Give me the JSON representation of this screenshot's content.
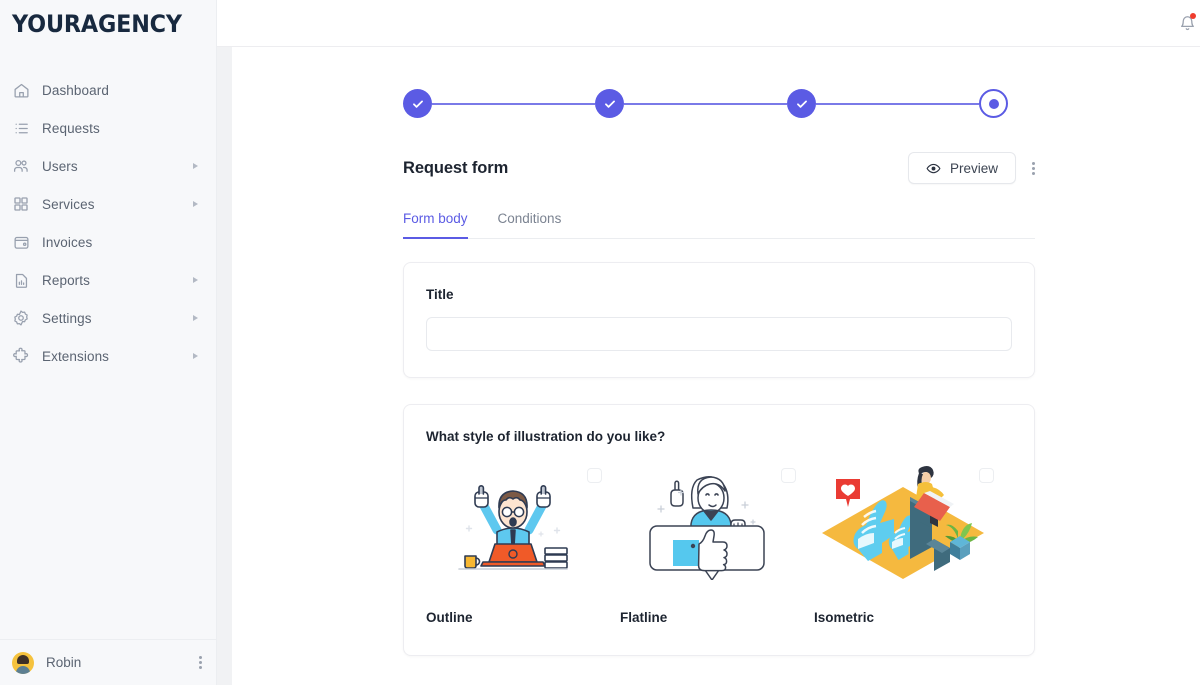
{
  "brand": {
    "logo_text": "YOURAGENCY",
    "accent": "#5b5be4",
    "logo_color": "#18293f"
  },
  "sidebar": {
    "items": [
      {
        "label": "Dashboard",
        "icon": "home-icon",
        "has_caret": false
      },
      {
        "label": "Requests",
        "icon": "list-icon",
        "has_caret": false
      },
      {
        "label": "Users",
        "icon": "users-icon",
        "has_caret": true
      },
      {
        "label": "Services",
        "icon": "grid-icon",
        "has_caret": true
      },
      {
        "label": "Invoices",
        "icon": "wallet-icon",
        "has_caret": false
      },
      {
        "label": "Reports",
        "icon": "report-chart-icon",
        "has_caret": true
      },
      {
        "label": "Settings",
        "icon": "gear-icon",
        "has_caret": true
      },
      {
        "label": "Extensions",
        "icon": "puzzle-icon",
        "has_caret": true
      }
    ],
    "footer": {
      "user_name": "Robin",
      "avatar": "user-avatar",
      "menu_icon": "more-vertical-icon"
    }
  },
  "topbar": {
    "notification_icon": "bell-icon",
    "has_unread": true,
    "unread_color": "#ef3c2d"
  },
  "stepper": {
    "steps": [
      {
        "state": "done",
        "icon": "check-icon"
      },
      {
        "state": "done",
        "icon": "check-icon"
      },
      {
        "state": "done",
        "icon": "check-icon"
      },
      {
        "state": "active",
        "icon": "dot-icon"
      }
    ]
  },
  "header": {
    "title": "Request form",
    "preview_label": "Preview",
    "preview_icon": "eye-icon",
    "more_icon": "more-vertical-icon"
  },
  "tabs": [
    {
      "label": "Form body",
      "active": true
    },
    {
      "label": "Conditions",
      "active": false
    }
  ],
  "title_card": {
    "label": "Title",
    "value": "",
    "placeholder": ""
  },
  "illustration_card": {
    "question": "What style of illustration do you like?",
    "options": [
      {
        "label": "Outline",
        "illustration": "cheering-person-laptop",
        "checked": false
      },
      {
        "label": "Flatline",
        "illustration": "thumbs-up-speech-bubble",
        "checked": false
      },
      {
        "label": "Isometric",
        "illustration": "isometric-thumbs-up-scene",
        "checked": false
      }
    ]
  }
}
